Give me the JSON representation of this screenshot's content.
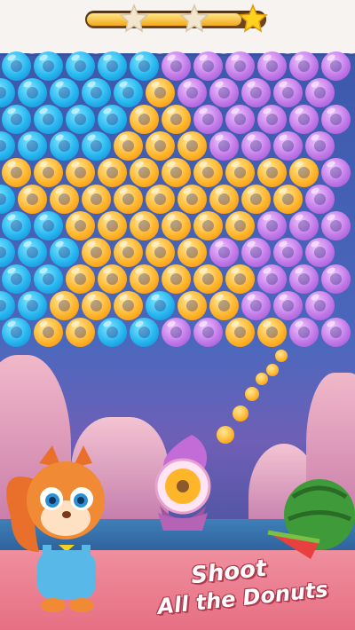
{
  "colors": {
    "blue": "#26b6ef",
    "purple": "#c27ae8",
    "yellow": "#ffb52a",
    "sky": "#3a56a8",
    "ground": "#e66f83"
  },
  "progress": {
    "fraction": 0.87,
    "stars_total": 3,
    "stars_earned": 1
  },
  "board": {
    "rows": [
      "BBBBBPPPPPP",
      "BBBBBYPPPPP",
      "BBBBYYPPPPP",
      "BBBBYYYPPPP",
      "YYYYYYYYYYP",
      "BYYYYYYYYYP",
      "BBYYYYYYPPP",
      "BBBYYYYPPPP",
      "BBYYYYYYPPP",
      "BBYYYBYYPPP",
      "BYYBBPPYYPP"
    ]
  },
  "shooter": {
    "loaded": "yellow"
  },
  "caption": {
    "line1": "Shoot",
    "line2": "All the Donuts"
  }
}
